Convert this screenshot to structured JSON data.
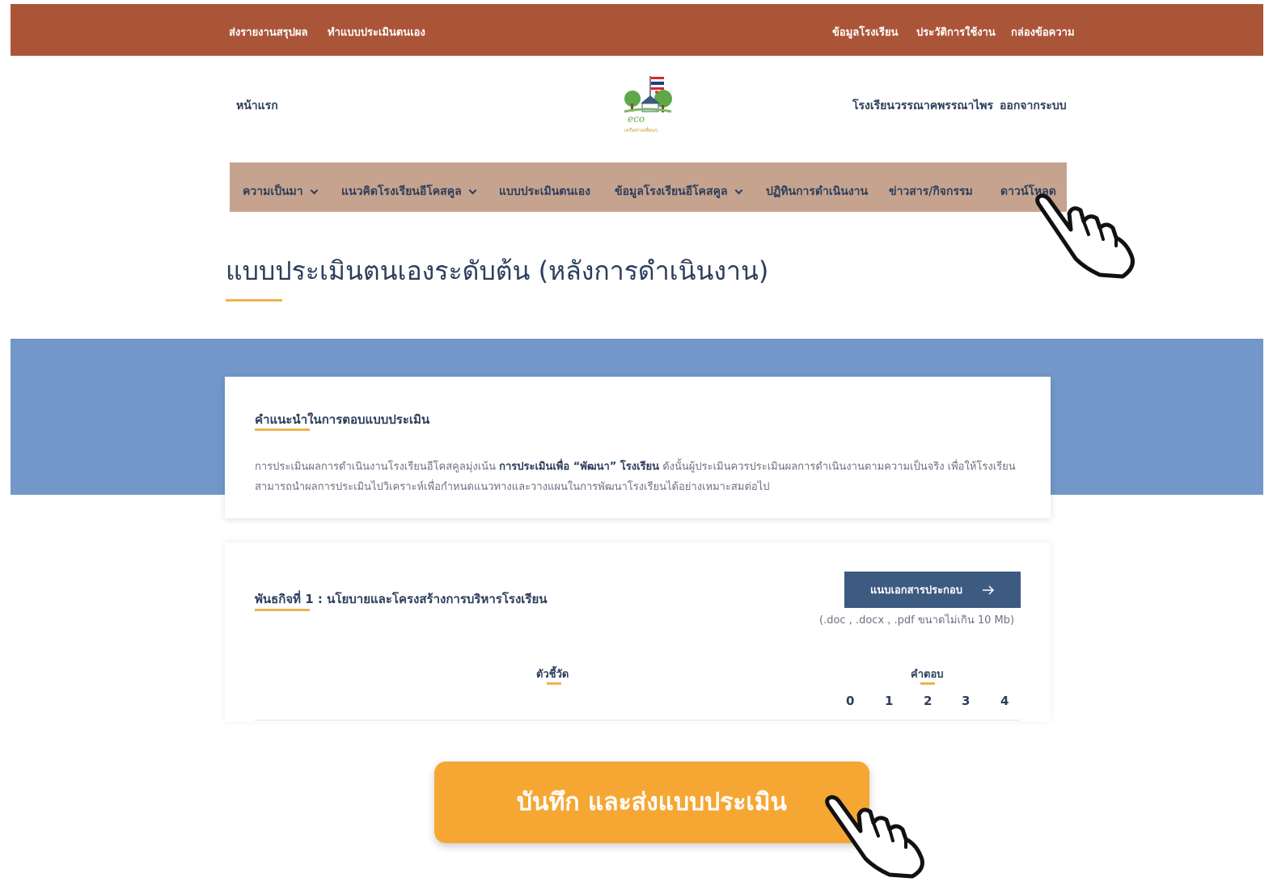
{
  "topbar": {
    "send_report": "ส่งรายงานสรุปผล",
    "self_assessment": "ทำแบบประเมินตนเอง",
    "school_info": "ข้อมูลโรงเรียน",
    "usage_history": "ประวัติการใช้งาน",
    "inbox": "กล่องข้อความ"
  },
  "header": {
    "home": "หน้าแรก",
    "logo_text": "eco",
    "logo_subtext": "เครือข่ายเพื่อนๆ",
    "school_name": "โรงเรียนวรรณาคพรรณาไพร",
    "logout": "ออกจากระบบ"
  },
  "nav": {
    "items": [
      {
        "label": "ความเป็นมา",
        "has_dropdown": true
      },
      {
        "label": "แนวคิดโรงเรียนอีโคสคูล",
        "has_dropdown": true
      },
      {
        "label": "แบบประเมินตนเอง",
        "has_dropdown": false
      },
      {
        "label": "ข้อมูลโรงเรียนอีโคสคูล",
        "has_dropdown": true
      },
      {
        "label": "ปฏิทินการดำเนินงาน",
        "has_dropdown": false
      },
      {
        "label": "ข่าวสาร/กิจกรรม",
        "has_dropdown": false
      },
      {
        "label": "ดาวน์โหลด",
        "has_dropdown": false
      }
    ]
  },
  "page": {
    "title": "แบบประเมินตนเองระดับต้น (หลังการดำเนินงาน)"
  },
  "instructions": {
    "heading": "คำแนะนำในการตอบแบบประเมิน",
    "text_before": "การประเมินผลการดำเนินงานโรงเรียนอีโคสคูลมุ่งเน้น ",
    "text_bold": "การประเมินเพื่อ “พัฒนา” โรงเรียน",
    "text_after": " ดังนั้นผู้ประเมินควรประเมินผลการดำเนินงานตามความเป็นจริง เพื่อให้โรงเรียนสามารถนำผลการประเมินไปวิเคราะห์เพื่อกำหนดแนวทางและวางแผนในการพัฒนาโรงเรียนได้อย่างเหมาะสมต่อไป"
  },
  "mission": {
    "heading": "พันธกิจที่ 1 : นโยบายและโครงสร้างการบริหารโรงเรียน",
    "doc_button": "แนบเอกสารประกอบ",
    "doc_button_icon": "arrow-right-icon",
    "doc_note": "(.doc , .docx , .pdf ขนาดไม่เกิน 10 Mb)",
    "indicator_header": "ตัวชี้วัด",
    "answer_header": "คำตอบ",
    "scores": [
      "0",
      "1",
      "2",
      "3",
      "4"
    ]
  },
  "submit": {
    "label": "บันทึก และส่งแบบประเมิน"
  },
  "colors": {
    "topbar": "#ab5538",
    "nav": "#c6a38e",
    "band": "#7297c8",
    "accent": "#f0b24e",
    "submit": "#f6a733",
    "text": "#2c3e5c"
  }
}
